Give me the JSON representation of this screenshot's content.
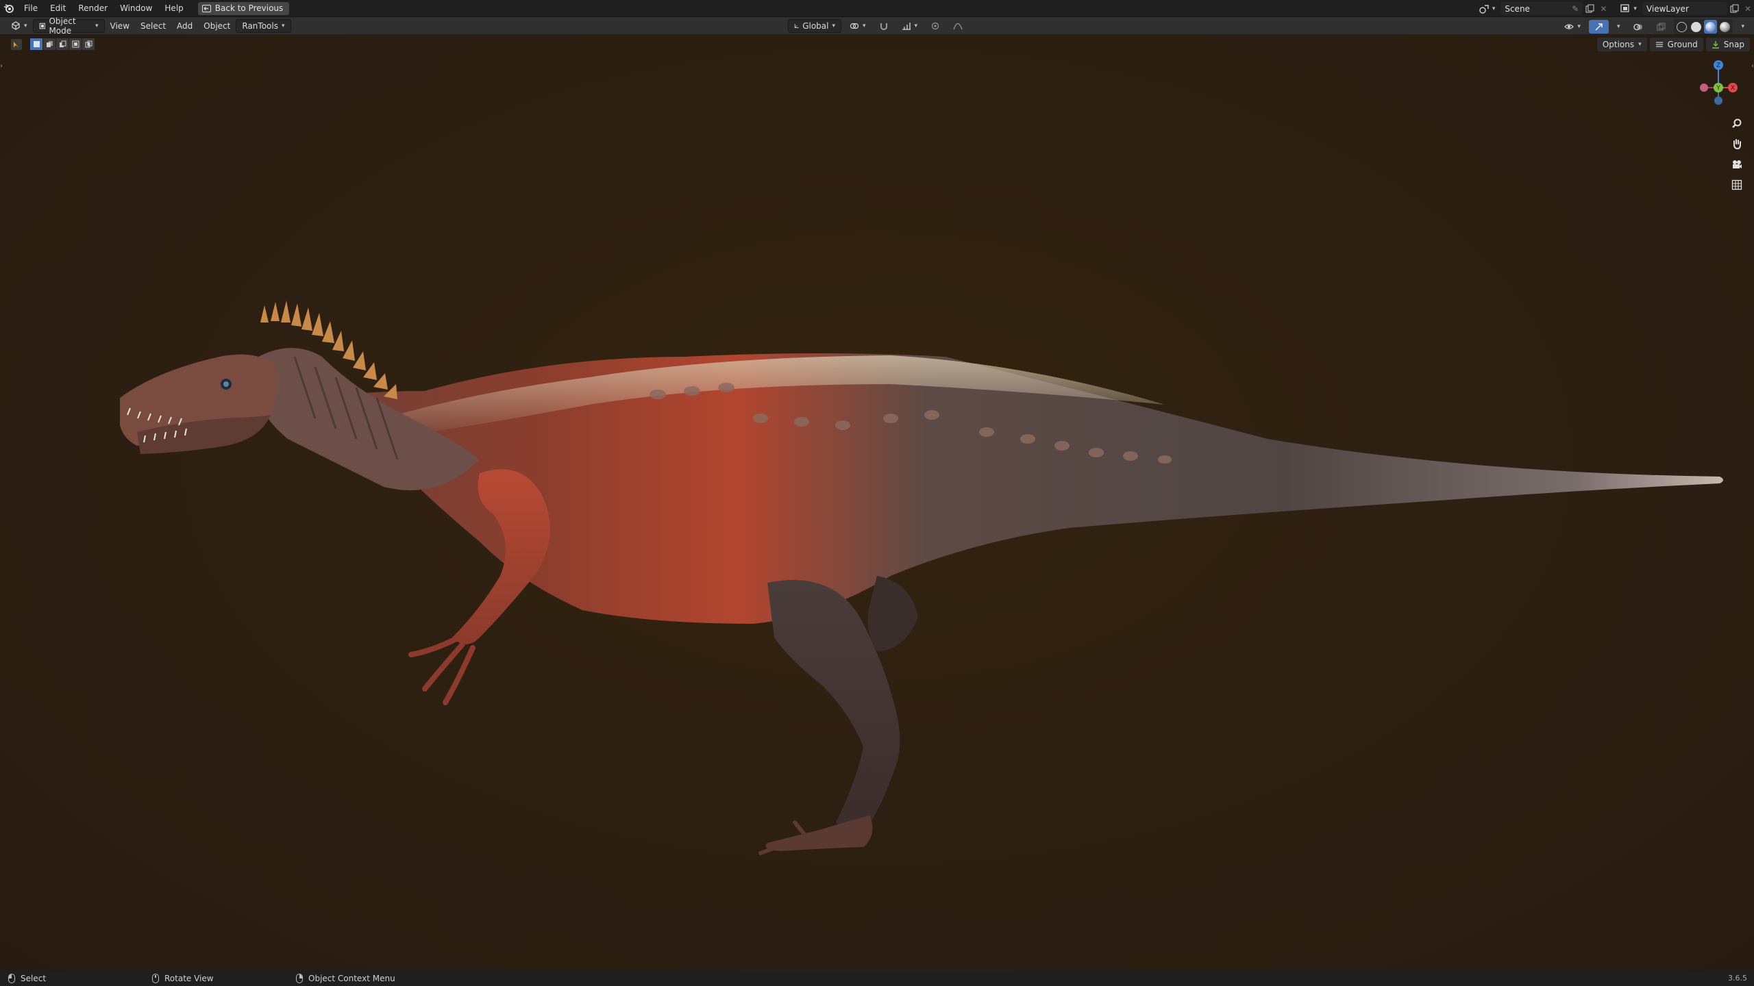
{
  "topbar": {
    "menus": [
      "File",
      "Edit",
      "Render",
      "Window",
      "Help"
    ],
    "back_button": "Back to Previous",
    "scene": "Scene",
    "view_layer": "ViewLayer"
  },
  "header": {
    "mode": "Object Mode",
    "menus": [
      "View",
      "Select",
      "Add",
      "Object",
      "RanTools"
    ],
    "transform_orientation": "Global"
  },
  "viewport_tools": {
    "options": "Options",
    "ground": "Ground",
    "snap": "Snap"
  },
  "gizmo": {
    "z": "Z",
    "y": "Y",
    "x": "X"
  },
  "statusbar": {
    "select": "Select",
    "rotate": "Rotate View",
    "context": "Object Context Menu",
    "version": "3.6.5"
  },
  "colors": {
    "viewport_bg": "#2c1f12",
    "x_axis": "#e0474f",
    "y_axis": "#7fc241",
    "z_axis": "#3f86d8",
    "active_blue": "#4772b3"
  }
}
